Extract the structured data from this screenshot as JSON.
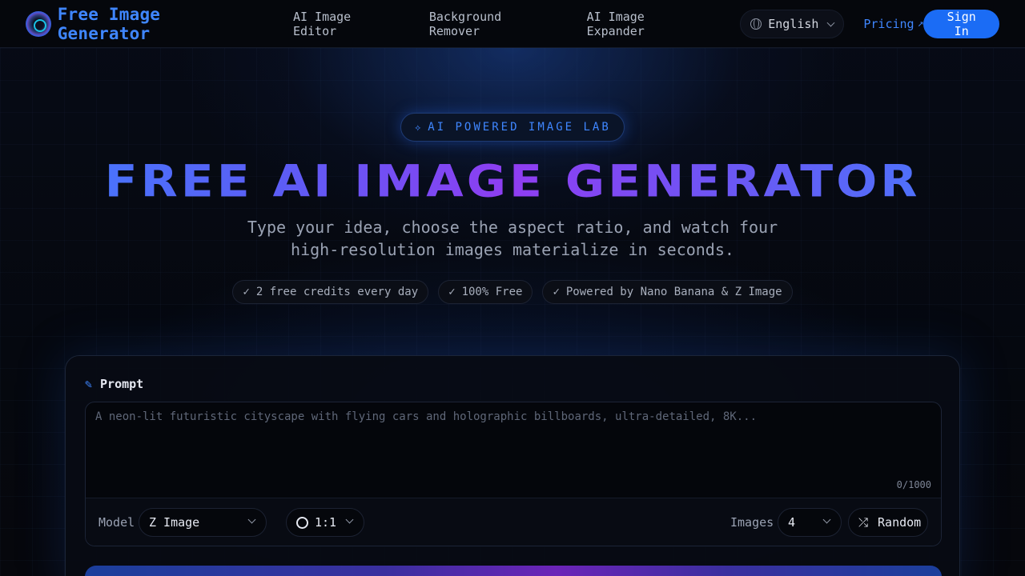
{
  "nav": {
    "brand": "Free Image Generator",
    "links": [
      "AI Image Editor",
      "Background Remover",
      "AI Image Expander"
    ],
    "language": "English",
    "pricing": "Pricing",
    "pricing_icon": "↗",
    "signin": "Sign In"
  },
  "hero": {
    "badge_icon": "✧",
    "badge": "AI POWERED IMAGE LAB",
    "title": "FREE AI IMAGE GENERATOR",
    "subtitle_line1": "Type your idea, choose the aspect ratio, and watch four",
    "subtitle_line2": "high-resolution images materialize in seconds.",
    "chips": [
      "2 free credits every day",
      "100% Free",
      "Powered by Nano Banana & Z Image"
    ],
    "check": "✓"
  },
  "panel": {
    "prompt_icon": "✎",
    "prompt_label": "Prompt",
    "prompt_placeholder": "A neon-lit futuristic cityscape with flying cars and holographic billboards, ultra-detailed, 8K...",
    "prompt_value": "",
    "counter": "0/1000",
    "model_label": "Model",
    "model_value": "Z Image",
    "ratio_value": "1:1",
    "images_label": "Images",
    "images_value": "4",
    "random_icon": "⤮",
    "random_label": "Random"
  },
  "colors": {
    "accent": "#3f86ff",
    "signin_bg": "#1b6cf5",
    "title_purple": "#8f3df2"
  }
}
